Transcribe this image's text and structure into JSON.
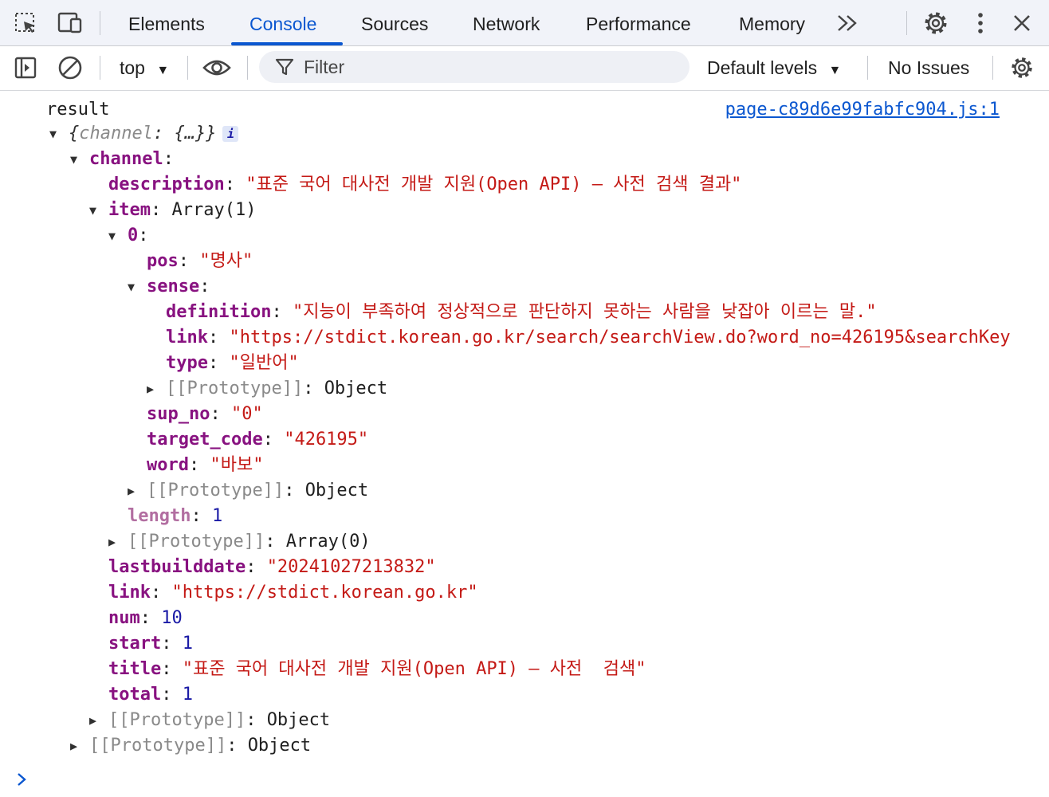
{
  "tabs": {
    "elements": "Elements",
    "console": "Console",
    "sources": "Sources",
    "network": "Network",
    "performance": "Performance",
    "memory": "Memory"
  },
  "toolbar": {
    "context": "top",
    "filter_placeholder": "Filter",
    "levels": "Default levels",
    "issues": "No Issues"
  },
  "log": {
    "label": "result",
    "source": "page-c89d6e99fabfc904.js:1",
    "preview_key": "channel",
    "preview_val": "{…}"
  },
  "tree": {
    "channel": "channel",
    "description_key": "description",
    "description": "\"표준 국어 대사전 개발 지원(Open API) — 사전 검색 결과\"",
    "item_key": "item",
    "item_val": "Array(1)",
    "idx0": "0",
    "pos_key": "pos",
    "pos": "\"명사\"",
    "sense_key": "sense",
    "definition_key": "definition",
    "definition": "\"지능이 부족하여 정상적으로 판단하지 못하는 사람을 낮잡아 이르는 말.\"",
    "link_key": "link",
    "sense_link": "\"https://stdict.korean.go.kr/search/searchView.do?word_no=426195&searchKey",
    "type_key": "type",
    "type": "\"일반어\"",
    "proto_key": "[[Prototype]]",
    "proto_object": "Object",
    "proto_array": "Array(0)",
    "sup_no_key": "sup_no",
    "sup_no": "\"0\"",
    "target_code_key": "target_code",
    "target_code": "\"426195\"",
    "word_key": "word",
    "word": "\"바보\"",
    "length_key": "length",
    "length": "1",
    "lastbuilddate_key": "lastbuilddate",
    "lastbuilddate": "\"20241027213832\"",
    "channel_link": "\"https://stdict.korean.go.kr\"",
    "num_key": "num",
    "num": "10",
    "start_key": "start",
    "start": "1",
    "title_key": "title",
    "title": "\"표준 국어 대사전 개발 지원(Open API) — 사전  검색\"",
    "total_key": "total",
    "total": "1"
  },
  "icons": {
    "inspect": "inspect-element-icon",
    "device": "device-toolbar-icon",
    "more_tabs": "chevron-double-right-icon",
    "settings": "gear-icon",
    "menu": "kebab-menu-icon",
    "close": "close-icon",
    "sidebar": "sidebar-toggle-icon",
    "clear": "clear-console-icon",
    "eye": "eye-icon",
    "filter": "filter-icon"
  }
}
